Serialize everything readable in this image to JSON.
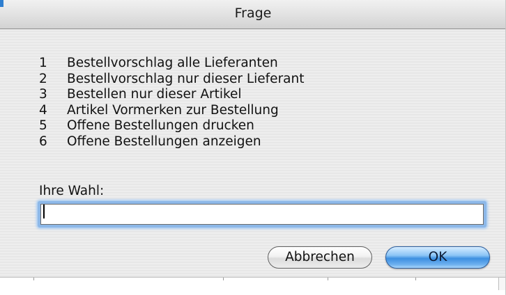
{
  "window": {
    "title": "Frage"
  },
  "options": [
    {
      "number": "1",
      "label": "Bestellvorschlag alle Lieferanten"
    },
    {
      "number": "2",
      "label": "Bestellvorschlag nur dieser Lieferant"
    },
    {
      "number": "3",
      "label": "Bestellen nur dieser Artikel"
    },
    {
      "number": "4",
      "label": "Artikel Vormerken zur Bestellung"
    },
    {
      "number": "5",
      "label": "Offene Bestellungen drucken"
    },
    {
      "number": "6",
      "label": "Offene Bestellungen anzeigen"
    }
  ],
  "prompt": {
    "label": "Ihre Wahl:",
    "value": ""
  },
  "buttons": {
    "cancel_label": "Abbrechen",
    "ok_label": "OK"
  },
  "colors": {
    "ok_button": "#3d8fe0",
    "focus_ring": "#8db8e8",
    "titlebar": "#e4e4e4",
    "background": "#ececec"
  }
}
